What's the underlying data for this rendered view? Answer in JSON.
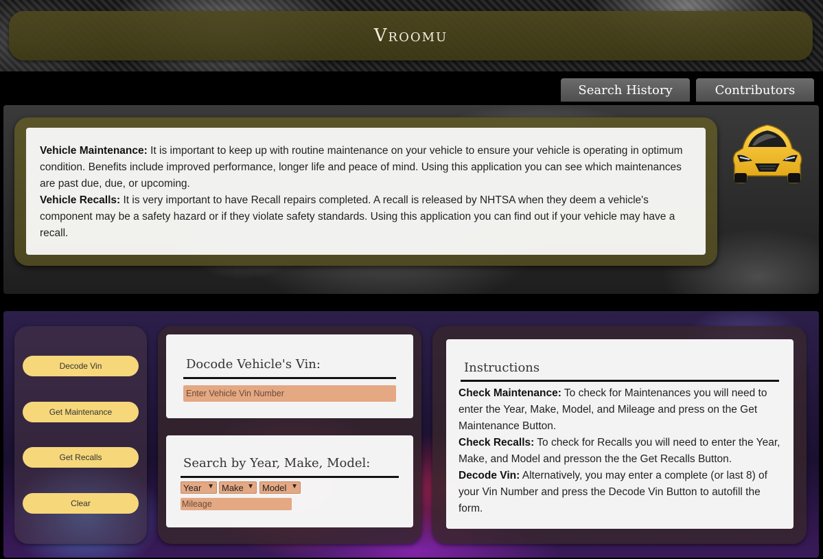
{
  "header": {
    "title": "Vroomu"
  },
  "nav": {
    "search_history": "Search History",
    "contributors": "Contributors"
  },
  "info": {
    "maintenance_label": "Vehicle Maintenance:",
    "maintenance_text": " It is important to keep up with routine maintenance on your vehicle to ensure your vehicle is operating in optimum condition. Benefits include improved performance, longer life and peace of mind. Using this application you can see which maintenances are past due, due, or upcoming.",
    "recalls_label": "Vehicle Recalls:",
    "recalls_text": " It is very important to have Recall repairs completed. A recall is released by NHTSA when they deem a vehicle's component may be a safety hazard or if they violate safety standards. Using this application you can find out if your vehicle may have a recall."
  },
  "buttons": {
    "decode_vin": "Decode Vin",
    "get_maintenance": "Get Maintenance",
    "get_recalls": "Get Recalls",
    "clear": "Clear"
  },
  "vin_search": {
    "heading": "Docode Vehicle's Vin:",
    "placeholder": "Enter Vehicle Vin Number"
  },
  "ymm_search": {
    "heading": "Search by Year, Make, Model:",
    "year": "Year",
    "make": "Make",
    "model": "Model",
    "mileage_placeholder": "Mileage"
  },
  "instructions": {
    "heading": "Instructions",
    "check_maintenance_label": "Check Maintenance:",
    "check_maintenance_text": " To check for Maintenances you will need to enter the Year, Make, Model, and Mileage and press on the Get Maintenance Button.",
    "check_recalls_label": "Check Recalls:",
    "check_recalls_text": " To check for Recalls you will need to enter the Year, Make, and Model and presson the the Get Recalls Button.",
    "decode_vin_label": "Decode Vin:",
    "decode_vin_text": " Alternatively, you may enter a complete (or last 8) of your Vin Number and press the Decode Vin Button to autofill the form."
  },
  "colors": {
    "header_bar": "#4e481e",
    "info_frame": "#5c5628",
    "button": "#f6d77a",
    "input": "#e4a883",
    "car_logo": "#f5c230"
  },
  "icons": {
    "logo": "sports-car-icon",
    "dropdown": "chevron-down-icon"
  }
}
